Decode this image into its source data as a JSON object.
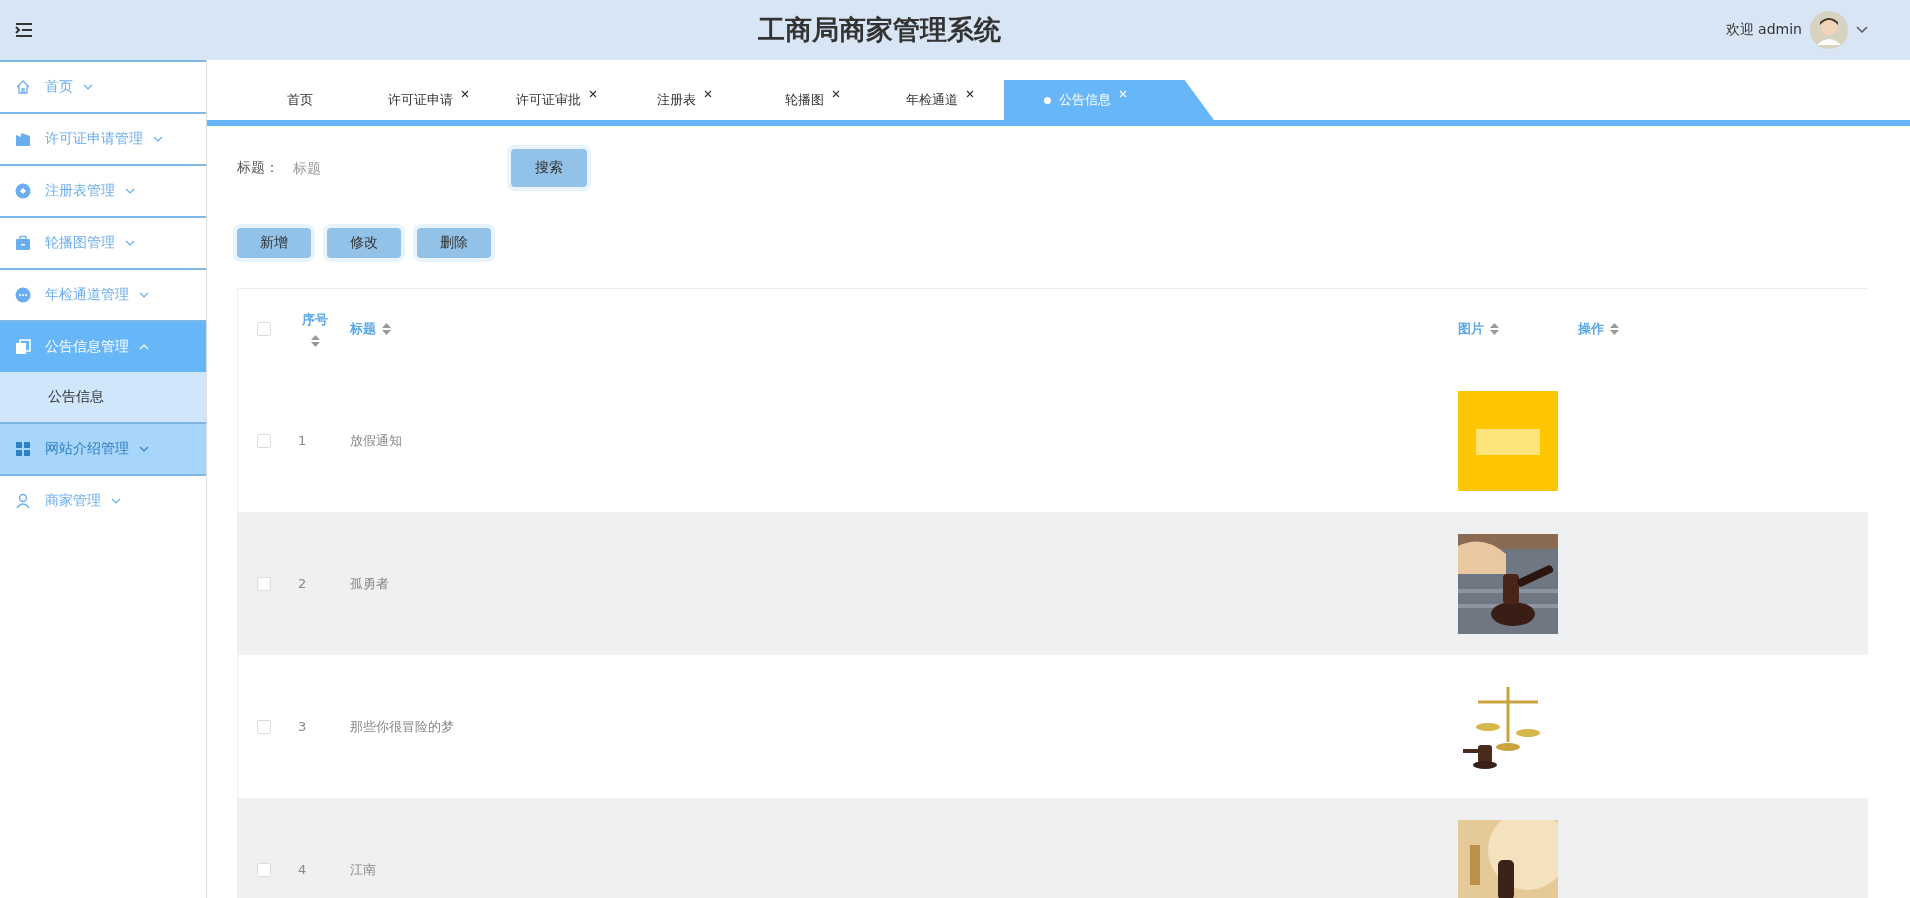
{
  "header": {
    "title": "工商局商家管理系统",
    "greeting": "欢迎 admin"
  },
  "sidebar": {
    "items": [
      {
        "label": "首页",
        "expanded": false,
        "hovered": false,
        "selected": false
      },
      {
        "label": "许可证申请管理",
        "expanded": false,
        "hovered": false,
        "selected": false
      },
      {
        "label": "注册表管理",
        "expanded": false,
        "hovered": false,
        "selected": false
      },
      {
        "label": "轮播图管理",
        "expanded": false,
        "hovered": false,
        "selected": false
      },
      {
        "label": "年检通道管理",
        "expanded": false,
        "hovered": false,
        "selected": false
      },
      {
        "label": "公告信息管理",
        "expanded": true,
        "hovered": false,
        "selected": true,
        "children": [
          {
            "label": "公告信息"
          }
        ]
      },
      {
        "label": "网站介绍管理",
        "expanded": false,
        "hovered": true,
        "selected": false
      },
      {
        "label": "商家管理",
        "expanded": false,
        "hovered": false,
        "selected": false
      }
    ]
  },
  "tabs": [
    {
      "label": "首页",
      "selected": false,
      "closable": false
    },
    {
      "label": "许可证申请",
      "selected": false,
      "closable": true
    },
    {
      "label": "许可证审批",
      "selected": false,
      "closable": true
    },
    {
      "label": "注册表",
      "selected": false,
      "closable": true
    },
    {
      "label": "轮播图",
      "selected": false,
      "closable": true
    },
    {
      "label": "年检通道",
      "selected": false,
      "closable": true
    },
    {
      "label": "公告信息",
      "selected": true,
      "closable": true
    }
  ],
  "search": {
    "label": "标题：",
    "placeholder": "标题",
    "button": "搜索"
  },
  "actions": [
    "新增",
    "修改",
    "删除"
  ],
  "table": {
    "select_all_checked": false,
    "columns": [
      "序号",
      "标题",
      "图片",
      "操作"
    ],
    "rows": [
      {
        "checked": false,
        "index": "1",
        "title": "放假通知"
      },
      {
        "checked": false,
        "index": "2",
        "title": "孤勇者"
      },
      {
        "checked": false,
        "index": "3",
        "title": "那些你很冒险的梦"
      },
      {
        "checked": false,
        "index": "4",
        "title": "江南"
      }
    ]
  }
}
